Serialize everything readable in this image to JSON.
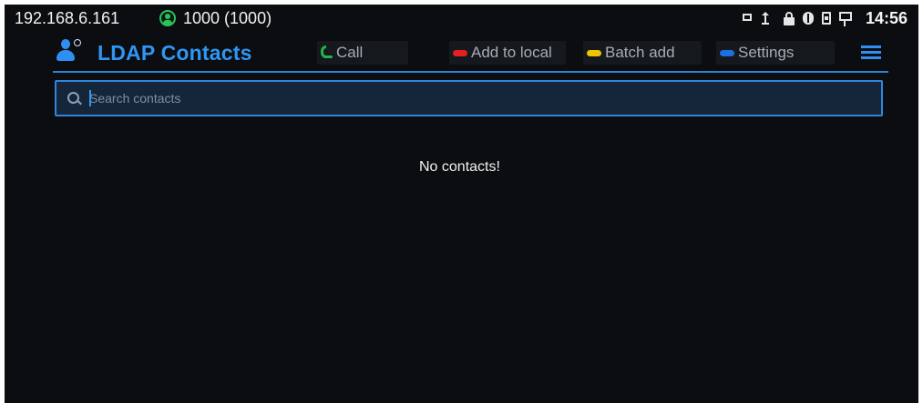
{
  "status_bar": {
    "ip": "192.168.6.161",
    "account": "1000 (1000)",
    "time": "14:56",
    "icons": [
      "image-icon",
      "upload-icon",
      "lock-icon",
      "bluetooth-icon",
      "sim-icon",
      "network-icon"
    ]
  },
  "header": {
    "title": "LDAP Contacts",
    "softkeys": {
      "call": "Call",
      "add_to_local": "Add to local",
      "batch_add": "Batch add",
      "settings": "Settings"
    },
    "colors": {
      "accent": "#2f96f4",
      "call": "#22b34b",
      "add_to_local": "#e51f1f",
      "batch_add": "#f0c400",
      "settings": "#1e6fe0"
    }
  },
  "search": {
    "placeholder": "Search contacts",
    "value": ""
  },
  "main": {
    "empty_message": "No contacts!"
  }
}
